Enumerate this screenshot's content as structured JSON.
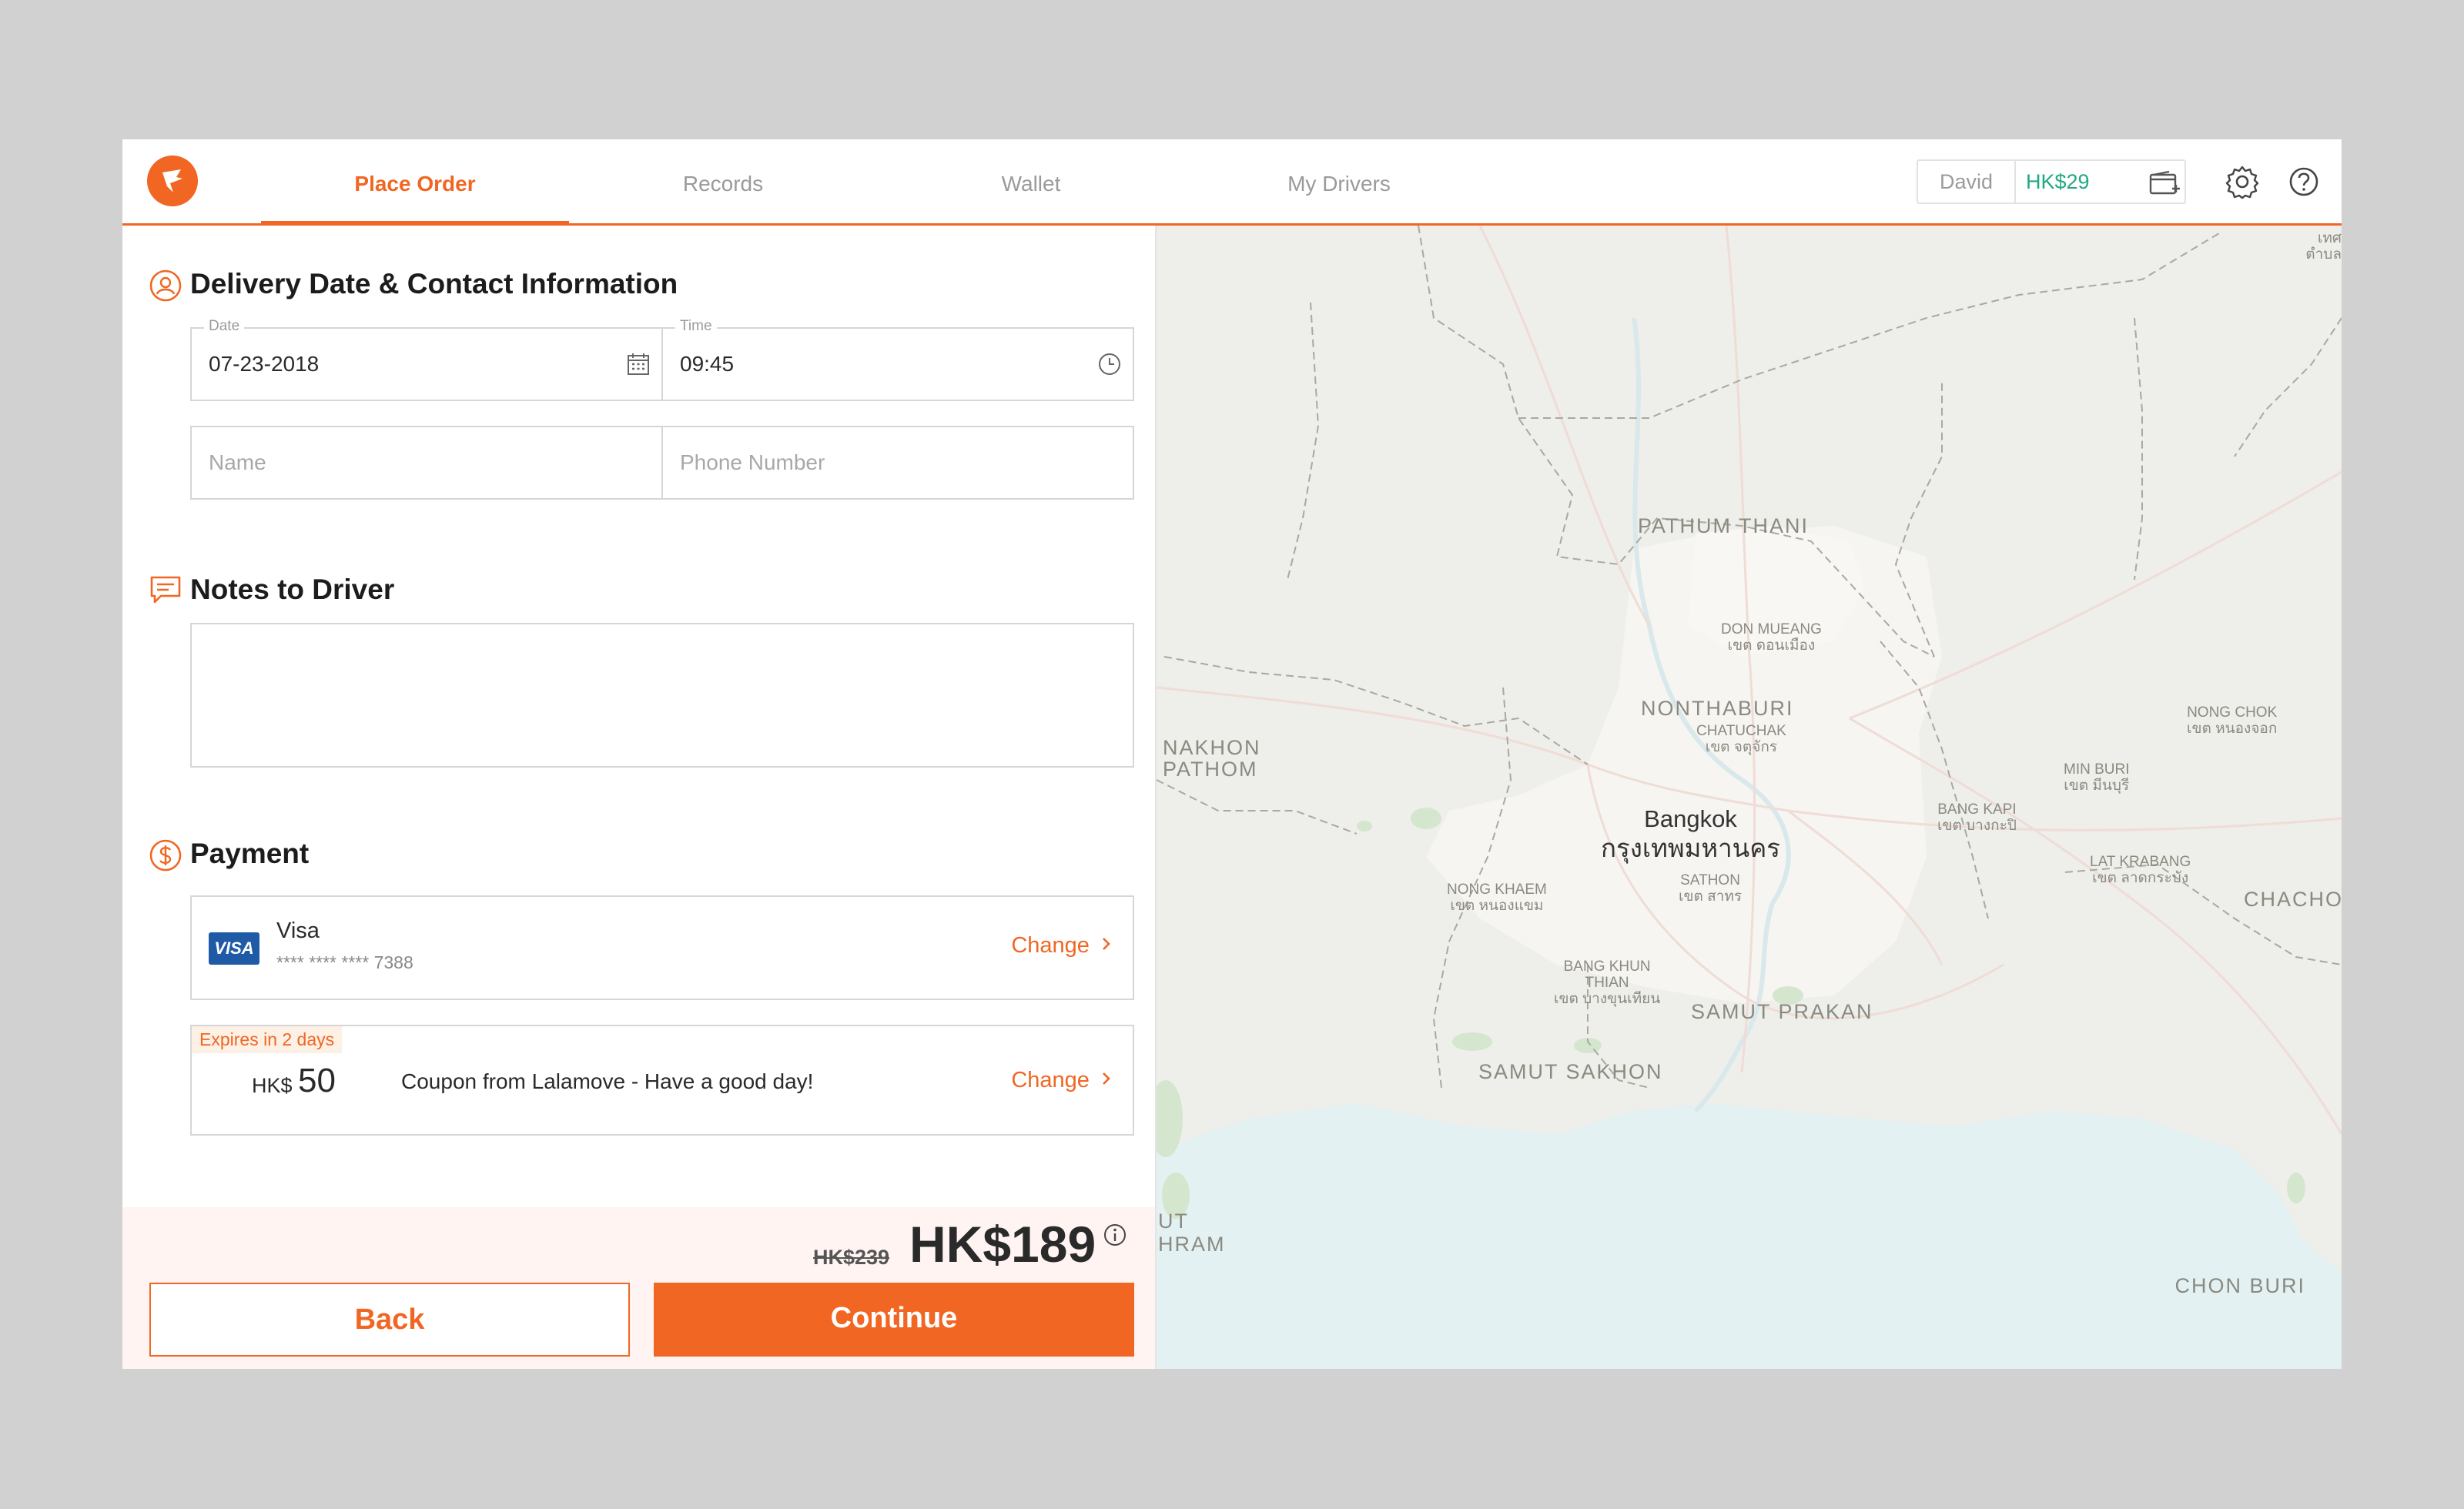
{
  "header": {
    "tabs": [
      {
        "label": "Place Order",
        "active": true
      },
      {
        "label": "Records"
      },
      {
        "label": "Wallet"
      },
      {
        "label": "My Drivers"
      }
    ],
    "account": {
      "user": "David",
      "balance": "HK$29"
    }
  },
  "delivery": {
    "title": "Delivery Date & Contact Information",
    "date_label": "Date",
    "date_value": "07-23-2018",
    "time_label": "Time",
    "time_value": "09:45",
    "name_placeholder": "Name",
    "phone_placeholder": "Phone Number"
  },
  "notes": {
    "title": "Notes to Driver",
    "value": ""
  },
  "payment": {
    "title": "Payment",
    "card": {
      "brand_logo": "VISA",
      "name": "Visa",
      "number": "**** **** **** 7388",
      "change_label": "Change"
    },
    "coupon": {
      "badge": "Expires in 2 days",
      "currency": "HK$",
      "amount": "50",
      "description": "Coupon from Lalamove - Have a good day!",
      "change_label": "Change"
    }
  },
  "summary": {
    "original_price": "HK$239",
    "price": "HK$189"
  },
  "actions": {
    "back_label": "Back",
    "continue_label": "Continue"
  },
  "map": {
    "labels": {
      "pathum_thani": "PATHUM THANI",
      "don_mueang": "DON MUEANG",
      "don_mueang_th": "เขต ดอนเมือง",
      "nonthaburi": "NONTHABURI",
      "chatuchak": "CHATUCHAK",
      "chatuchak_th": "เขต จตุจักร",
      "nakhon_pathom_1": "NAKHON",
      "nakhon_pathom_2": "PATHOM",
      "nong_chok": "NONG CHOK",
      "nong_chok_th": "เขต หนองจอก",
      "min_buri": "MIN BURI",
      "min_buri_th": "เขต มีนบุรี",
      "bang_kapi": "BANG KAPI",
      "bang_kapi_th": "เขต บางกะปิ",
      "bangkok": "Bangkok",
      "bangkok_th": "กรุงเทพมหานคร",
      "nong_khaem": "NONG KHAEM",
      "nong_khaem_th": "เขต หนองแขม",
      "sathon": "SATHON",
      "sathon_th": "เขต สาทร",
      "lat_krabang": "LAT KRABANG",
      "lat_krabang_th": "เขต ลาดกระบัง",
      "chacho": "CHACHO",
      "bang_khun_thian_1": "BANG KHUN",
      "bang_khun_thian_2": "THIAN",
      "bang_khun_thian_th": "เขต บางขุนเทียน",
      "samut_prakan": "SAMUT PRAKAN",
      "samut_sakhon": "SAMUT SAKHON",
      "ut": "UT",
      "hram": "HRAM",
      "chon_buri": "CHON BURI",
      "corner_1": "เทศ",
      "corner_2": "ตำบล"
    }
  },
  "colors": {
    "accent": "#f16622",
    "balance": "#22a884",
    "visa": "#1f5aa7"
  }
}
